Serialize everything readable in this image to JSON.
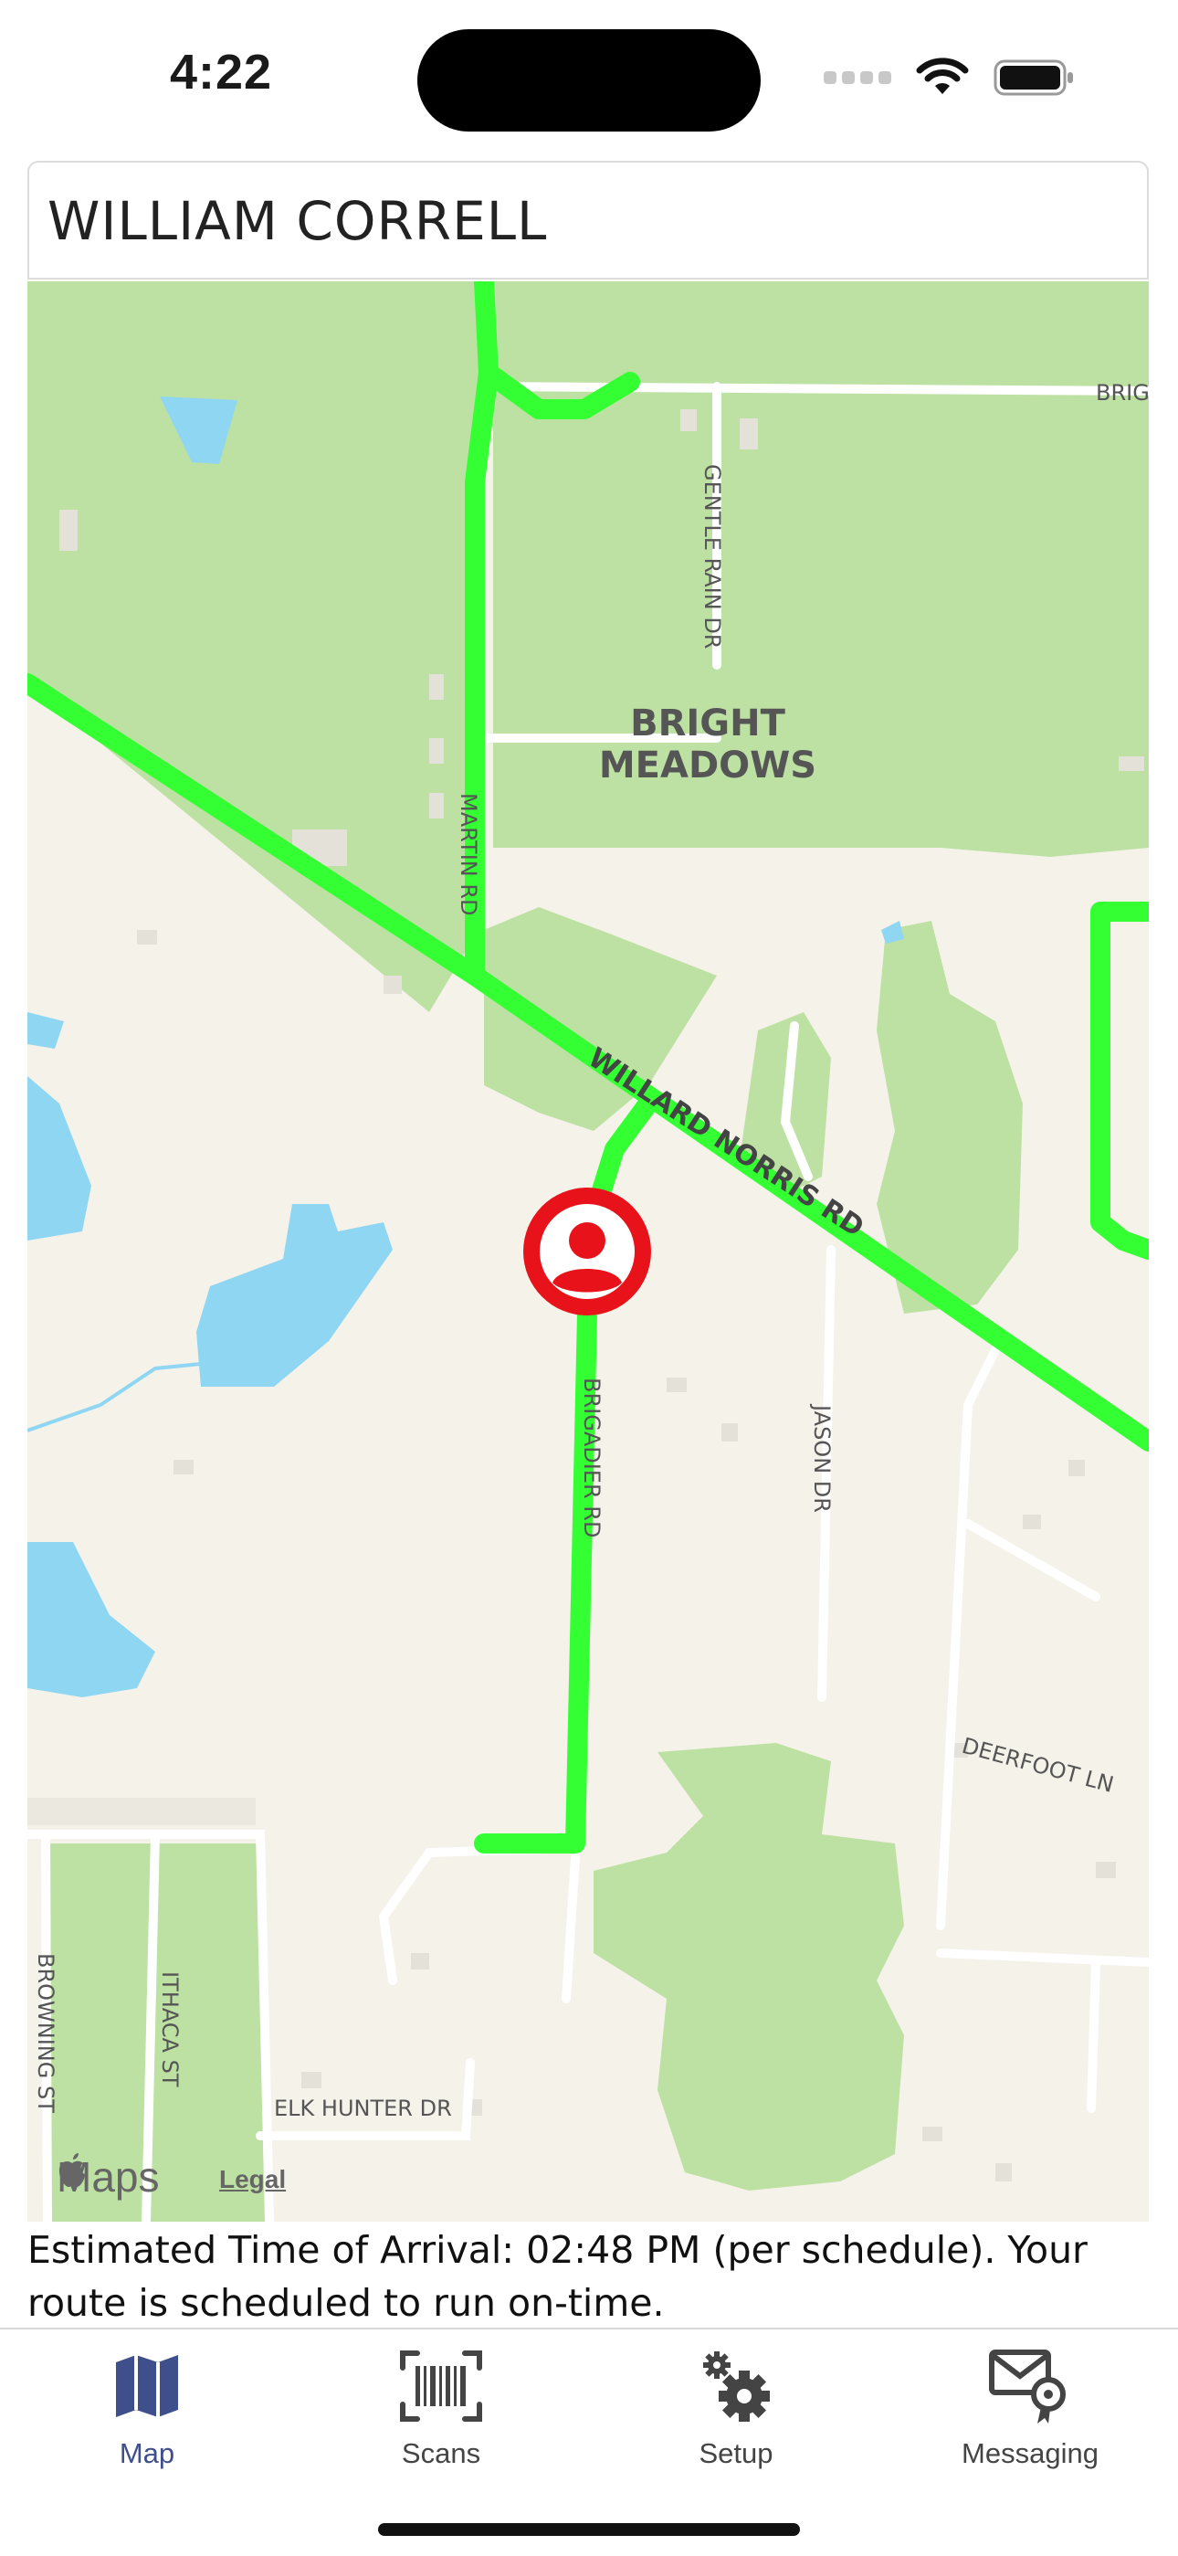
{
  "status_bar": {
    "time": "4:22"
  },
  "header": {
    "name": "WILLIAM CORRELL"
  },
  "map": {
    "area_label_line1": "BRIGHT",
    "area_label_line2": "MEADOWS",
    "streets": {
      "martin": "MARTIN RD",
      "gentle_rain": "GENTLE RAIN DR",
      "willard_norris": "WILLARD NORRIS RD",
      "brigadier": "BRIGADIER RD",
      "jason": "JASON DR",
      "deerfoot": "DEERFOOT LN",
      "browning": "BROWNING ST",
      "ithaca": "ITHACA ST",
      "elk_hunter": "ELK HUNTER DR",
      "brig_partial": "BRIG"
    },
    "logo_text": "Maps",
    "legal_text": "Legal",
    "route_color": "#33ff33",
    "marker_color": "#e8131a",
    "marker_icon": "person-icon"
  },
  "eta": {
    "text": "Estimated Time of Arrival: 02:48 PM (per schedule). Your route is scheduled to run on-time."
  },
  "tabs": [
    {
      "label": "Map",
      "icon": "map-icon",
      "active": true
    },
    {
      "label": "Scans",
      "icon": "barcode-icon",
      "active": false
    },
    {
      "label": "Setup",
      "icon": "gears-icon",
      "active": false
    },
    {
      "label": "Messaging",
      "icon": "message-badge-icon",
      "active": false
    }
  ],
  "colors": {
    "accent": "#3e4f8c",
    "park": "#bde1a2",
    "water": "#8fd6f2",
    "land": "#f5f2ea"
  }
}
